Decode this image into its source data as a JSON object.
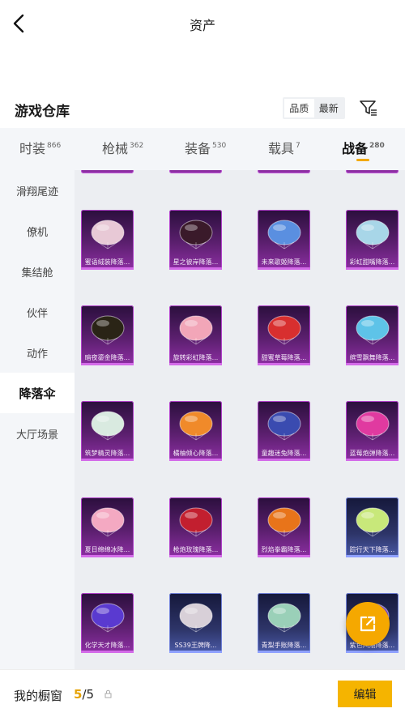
{
  "header": {
    "title": "资产"
  },
  "repository": {
    "title": "游戏仓库",
    "sort_options": [
      "品质",
      "最新"
    ],
    "active_sort": "品质"
  },
  "tabs": [
    {
      "label": "时装",
      "count": "866"
    },
    {
      "label": "枪械",
      "count": "362"
    },
    {
      "label": "装备",
      "count": "530"
    },
    {
      "label": "载具",
      "count": "7"
    },
    {
      "label": "战备",
      "count": "280",
      "active": true
    }
  ],
  "sidebar": {
    "items": [
      {
        "label": "滑翔尾迹"
      },
      {
        "label": "僚机"
      },
      {
        "label": "集结舱"
      },
      {
        "label": "伙伴"
      },
      {
        "label": "动作"
      },
      {
        "label": "降落伞",
        "active": true
      },
      {
        "label": "大厅场景"
      }
    ]
  },
  "items": [
    {
      "name": "蜜语绒装降落...",
      "rarity": "epic",
      "icon": "parachute-icon",
      "color": "#e8c9d6"
    },
    {
      "name": "星之彼岸降落...",
      "rarity": "epic",
      "icon": "parachute-icon",
      "color": "#3a1a2a"
    },
    {
      "name": "未来歌姬降落...",
      "rarity": "epic",
      "icon": "parachute-icon",
      "color": "#5a8fe0"
    },
    {
      "name": "彩虹甜嘴降落...",
      "rarity": "epic",
      "icon": "parachute-icon",
      "color": "#a8d6e8"
    },
    {
      "name": "暗夜鎏金降落...",
      "rarity": "epic",
      "icon": "parachute-icon",
      "color": "#2a2416"
    },
    {
      "name": "旋转彩虹降落...",
      "rarity": "epic",
      "icon": "parachute-icon",
      "color": "#f2a6b8"
    },
    {
      "name": "甜蜜草莓降落...",
      "rarity": "epic",
      "icon": "parachute-icon",
      "color": "#d82f2f"
    },
    {
      "name": "缤雪飘舞降落...",
      "rarity": "epic",
      "icon": "parachute-icon",
      "color": "#5ec3e8"
    },
    {
      "name": "筑梦精灵降落...",
      "rarity": "epic",
      "icon": "parachute-icon",
      "color": "#d9eae0"
    },
    {
      "name": "橘柚倾心降落...",
      "rarity": "epic",
      "icon": "parachute-icon",
      "color": "#f08a2a"
    },
    {
      "name": "童趣迷兔降落...",
      "rarity": "epic",
      "icon": "parachute-icon",
      "color": "#3a4bb0"
    },
    {
      "name": "蓝莓炮弹降落...",
      "rarity": "epic",
      "icon": "parachute-icon",
      "color": "#e03aa0"
    },
    {
      "name": "夏日绵绵冰降...",
      "rarity": "epic",
      "icon": "parachute-icon",
      "color": "#f4a9c2"
    },
    {
      "name": "枪炮玫瑰降落...",
      "rarity": "epic",
      "icon": "parachute-icon",
      "color": "#c21f2f"
    },
    {
      "name": "烈焰拳霸降落...",
      "rarity": "epic",
      "icon": "parachute-icon",
      "color": "#e8741a"
    },
    {
      "name": "踪行天下降落...",
      "rarity": "rare",
      "icon": "parachute-icon",
      "color": "#c8e87a"
    },
    {
      "name": "化学天才降落...",
      "rarity": "epic",
      "icon": "parachute-icon",
      "color": "#5a3ad0"
    },
    {
      "name": "SS39王牌降...",
      "rarity": "rare",
      "icon": "parachute-icon",
      "color": "#d8d0d8"
    },
    {
      "name": "青梨手账降落...",
      "rarity": "rare",
      "icon": "parachute-icon",
      "color": "#9ad0b8"
    },
    {
      "name": "紫色风潮降落...",
      "rarity": "rare",
      "icon": "parachute-icon",
      "color": "#7a4fd0"
    }
  ],
  "bottom": {
    "label": "我的橱窗",
    "current": "5",
    "total": "/5",
    "edit_label": "编辑"
  },
  "colors": {
    "accent": "#f5b400",
    "epic": "#8d2fa3",
    "rare": "#4a5aa6"
  }
}
